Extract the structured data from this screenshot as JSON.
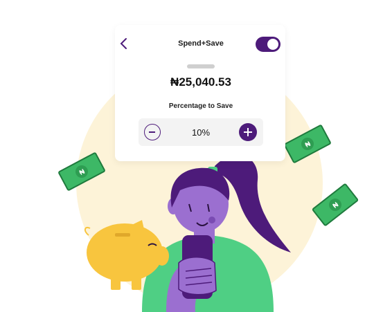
{
  "header": {
    "title": "Spend+Save",
    "toggle_on": true
  },
  "balance": {
    "amount": "₦25,040.53"
  },
  "savings": {
    "label": "Percentage to Save",
    "value": "10%"
  },
  "icons": {
    "back": "chevron-left-icon",
    "decrement": "minus-icon",
    "increment": "plus-icon",
    "currency_notes": "naira-banknote-icon",
    "piggy_bank": "piggy-bank-icon"
  },
  "colors": {
    "primary": "#4d1b7a",
    "accent_purple": "#9b6fd0",
    "green": "#4fcf84",
    "note_green": "#3db866",
    "cream": "#fdf3d8",
    "piggy": "#f8c53e"
  }
}
